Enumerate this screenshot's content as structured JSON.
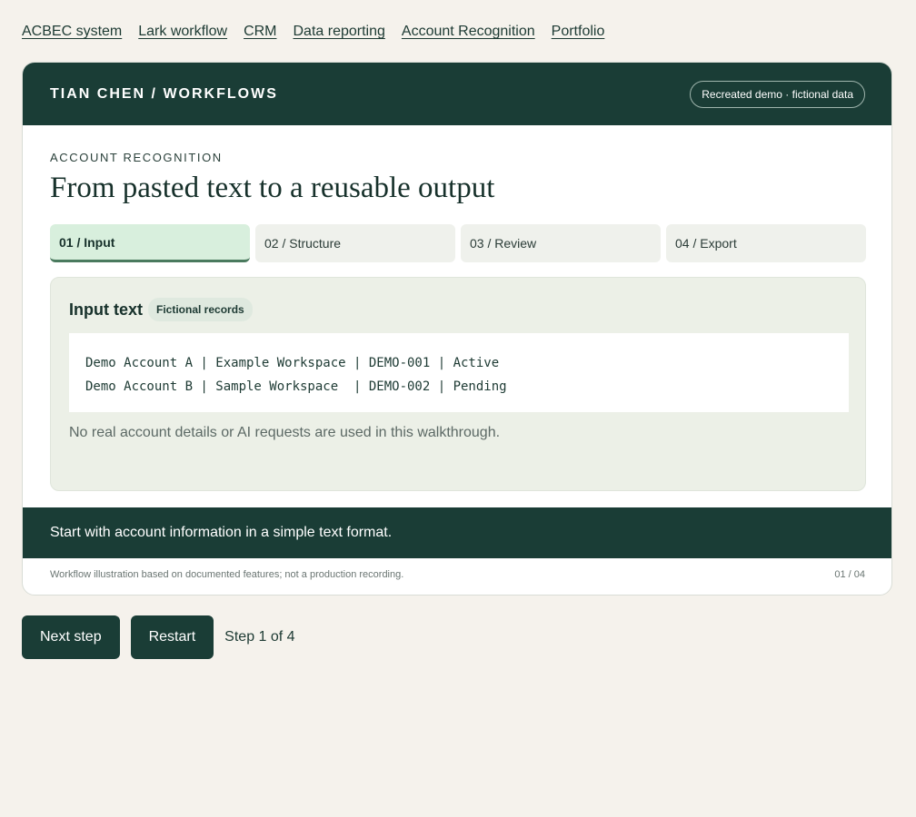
{
  "nav": {
    "links": [
      "ACBEC system",
      "Lark workflow",
      "CRM",
      "Data reporting",
      "Account Recognition",
      "Portfolio"
    ]
  },
  "header": {
    "brand": "TIAN CHEN / WORKFLOWS",
    "pill": "Recreated demo · fictional data"
  },
  "section": {
    "eyebrow": "ACCOUNT RECOGNITION",
    "title": "From pasted text to a reusable output"
  },
  "steps": [
    {
      "label": "01 / Input",
      "active": true
    },
    {
      "label": "02 / Structure",
      "active": false
    },
    {
      "label": "03 / Review",
      "active": false
    },
    {
      "label": "04 / Export",
      "active": false
    }
  ],
  "panel": {
    "title": "Input text",
    "badge": "Fictional records",
    "lines": [
      "Demo Account A | Example Workspace | DEMO-001 | Active",
      "Demo Account B | Sample Workspace  | DEMO-002 | Pending"
    ],
    "note": "No real account details or AI requests are used in this walkthrough."
  },
  "caption": "Start with account information in a simple text format.",
  "footer": {
    "disclaimer": "Workflow illustration based on documented features; not a production recording.",
    "page": "01 / 04"
  },
  "controls": {
    "next_label": "Next step",
    "restart_label": "Restart",
    "status": "Step 1 of 4"
  }
}
